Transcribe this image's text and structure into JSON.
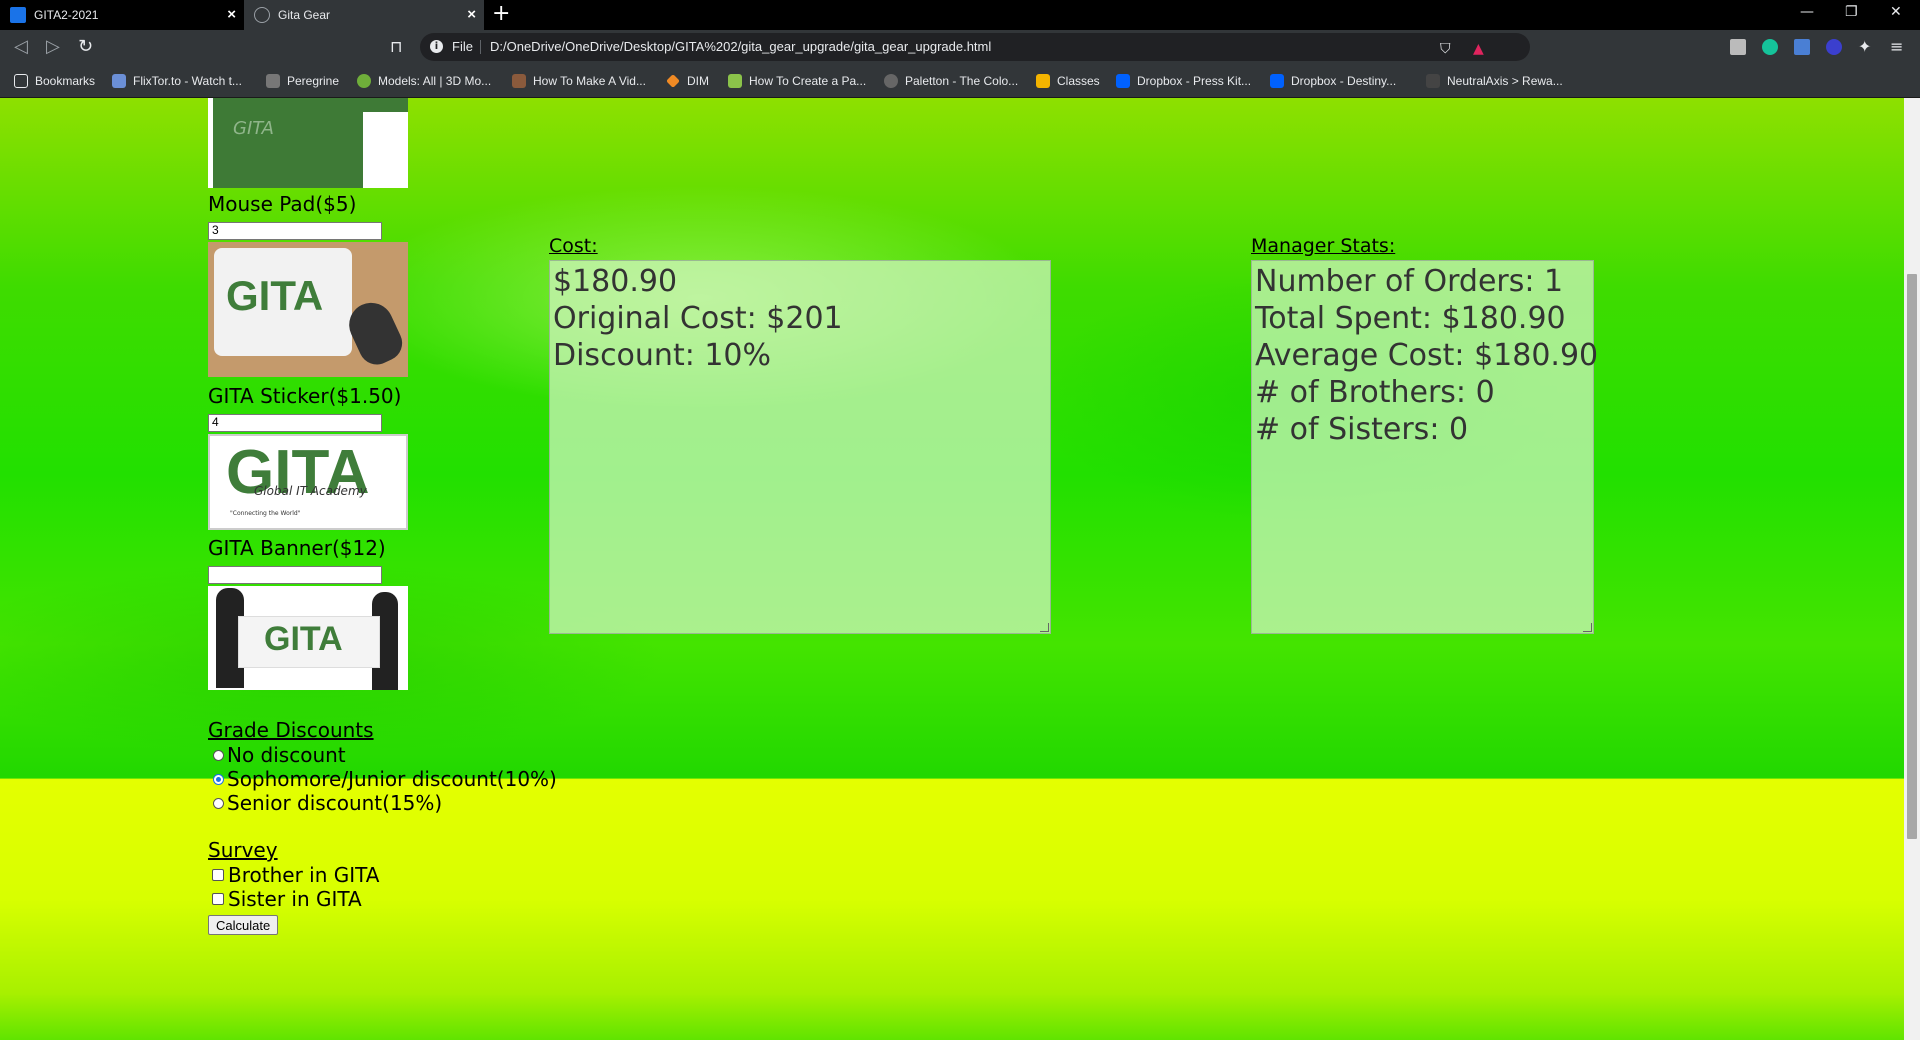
{
  "browser": {
    "tabs": [
      {
        "title": "GITA2-2021",
        "active": false,
        "icon": "classroom-icon"
      },
      {
        "title": "Gita Gear",
        "active": true,
        "icon": "globe-icon"
      }
    ],
    "url_scheme": "File",
    "url": "D:/OneDrive/OneDrive/Desktop/GITA%202/gita_gear_upgrade/gita_gear_upgrade.html",
    "bookmarks": [
      "Bookmarks",
      "FlixTor.to - Watch t...",
      "Peregrine",
      "Models: All | 3D Mo...",
      "How To Make A Vid...",
      "DIM",
      "How To Create a Pa...",
      "Paletton - The Colo...",
      "Classes",
      "Dropbox - Press Kit...",
      "Dropbox - Destiny...",
      "NeutralAxis > Rewa..."
    ]
  },
  "products": [
    {
      "label": "Mouse Pad($5)",
      "qty": "3",
      "image_text": "GITA"
    },
    {
      "label": "GITA Sticker($1.50)",
      "qty": "4",
      "image_text": "GITA",
      "image_sub": "Global IT Academy",
      "image_tag": "\"Connecting the World\""
    },
    {
      "label": "GITA Banner($12)",
      "qty": "",
      "image_text": "GITA"
    }
  ],
  "top_image_text": "GITA",
  "cost": {
    "heading": "Cost:",
    "lines": [
      "$180.90",
      "Original Cost: $201",
      "Discount: 10%"
    ]
  },
  "manager": {
    "heading": "Manager Stats:",
    "lines": [
      "Number of Orders: 1",
      "Total Spent: $180.90",
      "Average Cost: $180.90",
      "# of Brothers: 0",
      "# of Sisters: 0"
    ]
  },
  "grade_discounts": {
    "heading": "Grade Discounts",
    "options": [
      {
        "label": "No discount",
        "checked": false
      },
      {
        "label": "Sophomore/Junior discount(10%)",
        "checked": true
      },
      {
        "label": "Senior discount(15%)",
        "checked": false
      }
    ]
  },
  "survey": {
    "heading": "Survey",
    "options": [
      {
        "label": "Brother in GITA",
        "checked": false
      },
      {
        "label": "Sister in GITA",
        "checked": false
      }
    ]
  },
  "calculate_label": "Calculate"
}
